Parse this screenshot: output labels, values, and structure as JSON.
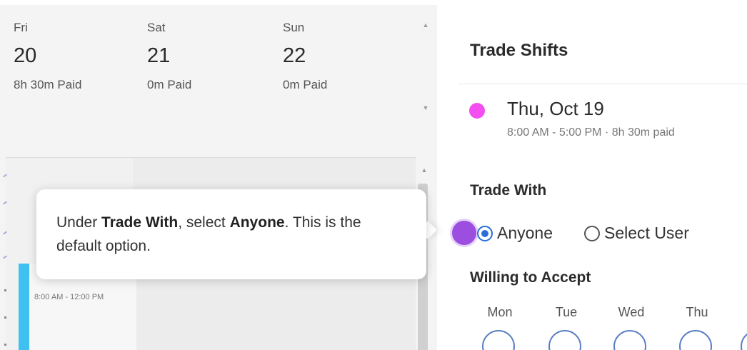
{
  "schedule": {
    "days": [
      {
        "dow": "Fri",
        "date": "20",
        "paid": "8h 30m Paid"
      },
      {
        "dow": "Sat",
        "date": "21",
        "paid": "0m Paid"
      },
      {
        "dow": "Sun",
        "date": "22",
        "paid": "0m Paid"
      }
    ],
    "shift_block": {
      "time": "8:00 AM - 12:00 PM",
      "color": "#3ec1f0"
    }
  },
  "tooltip": {
    "text_1": "Under ",
    "bold_1": "Trade With",
    "text_2": ", select ",
    "bold_2": "Anyone",
    "text_3": ". This is the default option."
  },
  "trade_panel": {
    "title": "Trade Shifts",
    "shift": {
      "color": "#f24ef0",
      "date": "Thu, Oct 19",
      "hours": "8:00 AM - 5:00 PM · 8h 30m paid"
    },
    "trade_with_label": "Trade With",
    "options": [
      {
        "label": "Anyone",
        "selected": true
      },
      {
        "label": "Select User",
        "selected": false
      }
    ],
    "willing_label": "Willing to Accept",
    "weekdays": [
      "Mon",
      "Tue",
      "Wed",
      "Thu"
    ]
  },
  "colors": {
    "accent": "#2a6fd6",
    "guide_dot": "#9b4ee0"
  }
}
